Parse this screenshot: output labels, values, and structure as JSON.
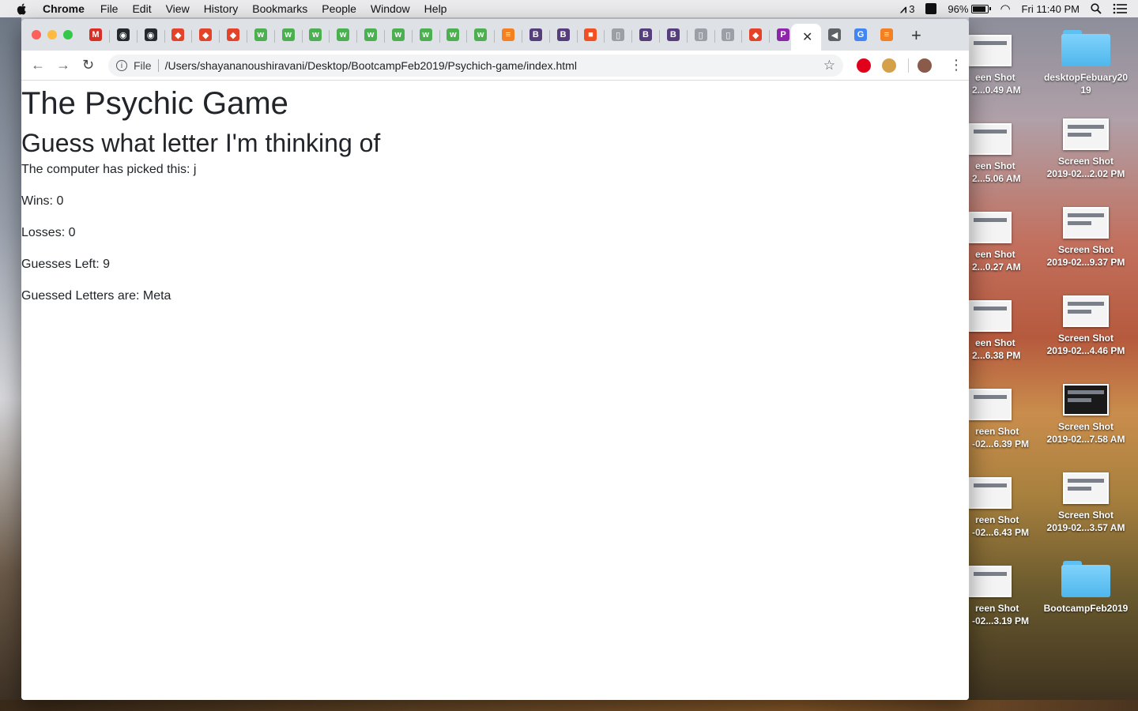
{
  "menubar": {
    "app_name": "Chrome",
    "items": [
      "File",
      "Edit",
      "View",
      "History",
      "Bookmarks",
      "People",
      "Window",
      "Help"
    ],
    "status_count": "3",
    "battery": "96%",
    "clock": "Fri 11:40 PM"
  },
  "browser": {
    "address": {
      "scheme_label": "File",
      "url": "/Users/shayananoushiravani/Desktop/BootcampFeb2019/Psychich-game/index.html"
    },
    "tabs": [
      {
        "icon": "gmail-icon",
        "color": "#d93025",
        "glyph": "M"
      },
      {
        "icon": "github-icon",
        "color": "#24292e",
        "glyph": "◉"
      },
      {
        "icon": "github-icon",
        "color": "#24292e",
        "glyph": "◉"
      },
      {
        "icon": "gitlab-icon",
        "color": "#e24329",
        "glyph": "◆"
      },
      {
        "icon": "gitlab-icon",
        "color": "#e24329",
        "glyph": "◆"
      },
      {
        "icon": "gitlab-icon",
        "color": "#e24329",
        "glyph": "◆"
      },
      {
        "icon": "w3schools-icon",
        "color": "#4caf50",
        "glyph": "w"
      },
      {
        "icon": "w3schools-icon",
        "color": "#4caf50",
        "glyph": "w"
      },
      {
        "icon": "w3schools-icon",
        "color": "#4caf50",
        "glyph": "w"
      },
      {
        "icon": "w3schools-icon",
        "color": "#4caf50",
        "glyph": "w"
      },
      {
        "icon": "w3schools-icon",
        "color": "#4caf50",
        "glyph": "w"
      },
      {
        "icon": "w3schools-icon",
        "color": "#4caf50",
        "glyph": "w"
      },
      {
        "icon": "w3schools-icon",
        "color": "#4caf50",
        "glyph": "w"
      },
      {
        "icon": "w3schools-icon",
        "color": "#4caf50",
        "glyph": "w"
      },
      {
        "icon": "w3schools-icon",
        "color": "#4caf50",
        "glyph": "w"
      },
      {
        "icon": "stackoverflow-icon",
        "color": "#f48024",
        "glyph": "≡"
      },
      {
        "icon": "bootstrap-icon",
        "color": "#563d7c",
        "glyph": "B"
      },
      {
        "icon": "bootstrap-icon",
        "color": "#563d7c",
        "glyph": "B"
      },
      {
        "icon": "microsoft-icon",
        "color": "#f25022",
        "glyph": "■"
      },
      {
        "icon": "document-icon",
        "color": "#9aa0a6",
        "glyph": "▯"
      },
      {
        "icon": "bootstrap-icon",
        "color": "#563d7c",
        "glyph": "B"
      },
      {
        "icon": "bootstrap-icon",
        "color": "#563d7c",
        "glyph": "B"
      },
      {
        "icon": "document-icon",
        "color": "#9aa0a6",
        "glyph": "▯"
      },
      {
        "icon": "document-icon",
        "color": "#9aa0a6",
        "glyph": "▯"
      },
      {
        "icon": "gitlab-icon",
        "color": "#e24329",
        "glyph": "◆"
      },
      {
        "icon": "flag-icon",
        "color": "#8e24aa",
        "glyph": "P"
      }
    ],
    "tabs_after": [
      {
        "icon": "audio-icon",
        "color": "#5f6368",
        "glyph": "◀"
      },
      {
        "icon": "google-icon",
        "color": "#4285f4",
        "glyph": "G"
      },
      {
        "icon": "stackoverflow-icon",
        "color": "#f48024",
        "glyph": "≡"
      }
    ]
  },
  "page": {
    "title": "The Psychic Game",
    "subtitle": "Guess what letter I'm thinking of",
    "picked": "The computer has picked this: j",
    "wins": "Wins: 0",
    "losses": "Losses: 0",
    "guesses_left": "Guesses Left: 9",
    "guessed_letters": "Guessed Letters are: Meta"
  },
  "desktop": {
    "left_column": [
      "een Shot",
      "2...0.49 AM",
      "een Shot",
      "2...5.06 AM",
      "een Shot",
      "2...0.27 AM",
      "een Shot",
      "2...6.38 PM",
      "reen Shot",
      "-02...6.39 PM",
      "reen Shot",
      "-02...6.43 PM",
      "reen Shot",
      "-02...3.19 PM"
    ],
    "right_column": [
      {
        "line1": "desktopFebuary20",
        "line2": "19",
        "kind": "folder"
      },
      {
        "line1": "Screen Shot",
        "line2": "2019-02...2.02 PM",
        "kind": "shot"
      },
      {
        "line1": "Screen Shot",
        "line2": "2019-02...9.37 PM",
        "kind": "shot"
      },
      {
        "line1": "Screen Shot",
        "line2": "2019-02...4.46 PM",
        "kind": "shot"
      },
      {
        "line1": "Screen Shot",
        "line2": "2019-02...7.58 AM",
        "kind": "shot-dark"
      },
      {
        "line1": "Screen Shot",
        "line2": "2019-02...3.57 AM",
        "kind": "shot"
      },
      {
        "line1": "BootcampFeb2019",
        "line2": "",
        "kind": "folder"
      }
    ]
  }
}
